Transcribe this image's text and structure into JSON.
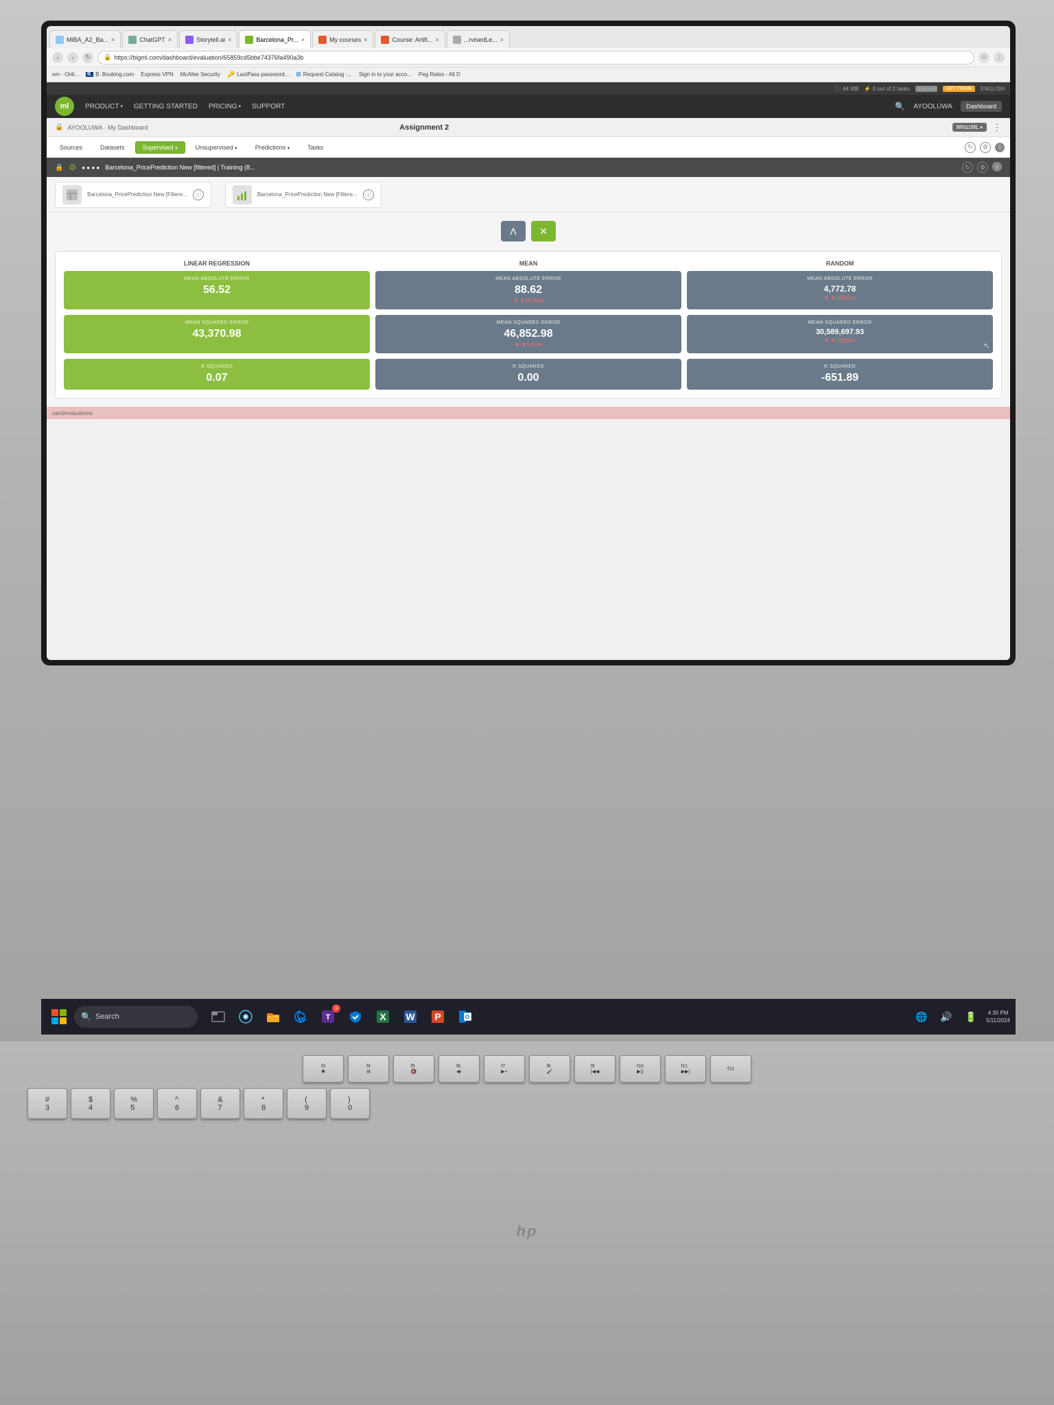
{
  "browser": {
    "tabs": [
      {
        "label": "MiBA_A2_Ba...",
        "favicon_color": "#ccc",
        "active": false
      },
      {
        "label": "ChatGPT",
        "favicon_color": "#74aa9c",
        "active": false
      },
      {
        "label": "Storytell.ai",
        "favicon_color": "#8b5cf6",
        "active": false
      },
      {
        "label": "Barcelona_Pr...",
        "favicon_color": "#7cb82f",
        "active": true
      },
      {
        "label": "My courses",
        "favicon_color": "#e05a2b",
        "active": false
      },
      {
        "label": "Course: Artifi...",
        "favicon_color": "#e05a2b",
        "active": false
      },
      {
        "label": "...rvisedLe...",
        "favicon_color": "#ccc",
        "active": false
      }
    ],
    "address": "https://bigml.com/dashboard/evaluation/65859cd5bbe74376fa490a3b",
    "bookmarks": [
      "em - Onli...",
      "B. Booking.com",
      "Express VPN",
      "McAfee Security",
      "LastPass password...",
      "Request Catalog -...",
      "Sign in to your acco...",
      "Peg Rates - All D"
    ]
  },
  "system_bar": {
    "memory": "64 MB",
    "tasks": "0 out of 2 tasks",
    "queue_label": "queued",
    "prime_label": "GET PRIME",
    "language": "ENGLISH"
  },
  "bigml": {
    "logo_text": "ml",
    "nav_items": [
      "PRODUCT",
      "GETTING STARTED",
      "PRICING",
      "SUPPORT"
    ],
    "user": "AYOOLUWA",
    "dashboard_btn": "Dashboard",
    "breadcrumb": "AYOOLUWA · My Dashboard",
    "assignment_title": "Assignment 2",
    "whizzml_label": "WhizzML",
    "secondary_nav": {
      "sources_label": "Sources",
      "datasets_label": "Datasets",
      "supervised_label": "Supervised",
      "unsupervised_label": "Unsupervised",
      "predictions_label": "Predictions",
      "tasks_label": "Tasks"
    },
    "model_title": "Barcelona_PricePrediction New [filtered] | Training (8...",
    "model_card_1": "Barcelona_PricePrediction New [Filtere...",
    "model_card_2": "Barcelona_PricePrediction New [Filtere...",
    "evaluation": {
      "sections": {
        "linear_regression": {
          "header": "LINEAR REGRESSION",
          "metrics": [
            {
              "label": "MEAN ABSOLUTE ERROR",
              "value": "56.52",
              "delta": null,
              "color": "green"
            },
            {
              "label": "MEAN SQUARED ERROR",
              "value": "43,370.98",
              "delta": null,
              "color": "green"
            },
            {
              "label": "R SQUARED",
              "value": "0.07",
              "delta": null,
              "color": "green"
            }
          ]
        },
        "mean": {
          "header": "MEAN",
          "metrics": [
            {
              "label": "MEAN ABSOLUTE ERROR",
              "value": "88.62",
              "delta": "▼56.79%",
              "color": "gray"
            },
            {
              "label": "MEAN SQUARED ERROR",
              "value": "46,852.98",
              "delta": "▼8.03%",
              "color": "gray"
            },
            {
              "label": "R SQUARED",
              "value": "0.00",
              "delta": null,
              "color": "gray"
            }
          ]
        },
        "random": {
          "header": "RANDOM",
          "metrics": [
            {
              "label": "MEAN ABSOLUTE ERROR",
              "value": "4,772.78",
              "delta": "▼1000%+",
              "color": "gray"
            },
            {
              "label": "MEAN SQUARED ERROR",
              "value": "30,589,697.93",
              "delta": "▼1000%+",
              "color": "gray"
            },
            {
              "label": "R SQUARED",
              "value": "-651.89",
              "delta": null,
              "color": "gray"
            }
          ]
        }
      }
    }
  },
  "taskbar": {
    "search_placeholder": "Search",
    "apps": [
      "📁",
      "🎥",
      "🗂️",
      "🌐",
      "🔵"
    ],
    "time": "4:30 PM"
  },
  "keyboard": {
    "fn_keys": [
      "f3 ✱",
      "f4 ⊞",
      "f5 🔇",
      "f6 🔉-",
      "f7 🔊+",
      "f8 🎤",
      "f9 |◀◀",
      "f10 ▶||",
      "f11 ▶▶|",
      "f12",
      "f11"
    ],
    "number_row": [
      "#\n3",
      "$\n4",
      "%\n5",
      "^\n6",
      "&\n7",
      "*\n8",
      "(\n9",
      ")\n0"
    ]
  }
}
